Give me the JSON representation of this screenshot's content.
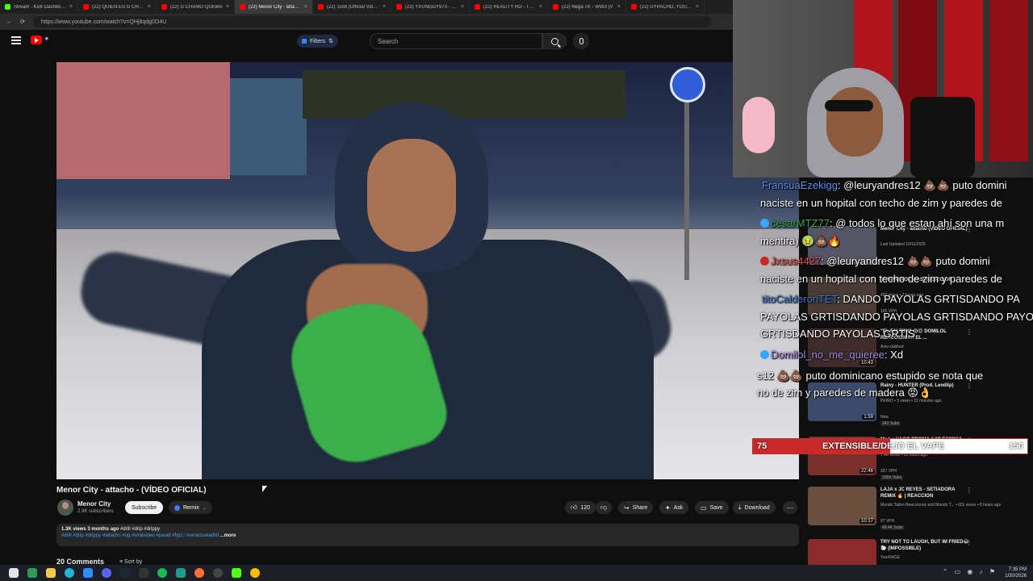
{
  "browser": {
    "tabs": [
      {
        "title": "Stream - Kick Dashboard",
        "color": "#53fc18",
        "active": false
      },
      {
        "title": "(22) QUIEN ES G CHAMO",
        "color": "#ff0000",
        "active": false
      },
      {
        "title": "(22) G CHAMO QUEMA",
        "color": "#ff0000",
        "active": false
      },
      {
        "title": "(22) Menor City - attacho",
        "color": "#ff0000",
        "active": true
      },
      {
        "title": "(22) 1vs8 (Official Video)",
        "color": "#ff0000",
        "active": false
      },
      {
        "title": "(22) YXUNGDY970 - GAR",
        "color": "#ff0000",
        "active": false
      },
      {
        "title": "(22) REALITY RD - TRUST",
        "color": "#ff0000",
        "active": false
      },
      {
        "title": "(22) Nega TK - WW3 (V",
        "color": "#ff0000",
        "active": false
      },
      {
        "title": "(22) UYPACHO, YOUNG",
        "color": "#ff0000",
        "active": false
      }
    ],
    "url": "https://www.youtube.com/watch?v=QHj8qdg0O4U"
  },
  "header": {
    "filters_label": "Filters",
    "search_placeholder": "Search"
  },
  "video": {
    "title": "Menor City - attacho - (VÍDEO OFICIAL)",
    "channel": "Menor City",
    "subscribers": "2.8K subscribers",
    "subscribe_label": "Subscribe",
    "remix_label": "Remix",
    "likes": "120",
    "share_label": "Share",
    "ask_label": "Ask",
    "save_label": "Save",
    "download_label": "Download",
    "views_date": "1.3K views  3 months ago",
    "hashtags_top": "#drill #drip #drippy",
    "hashtags": "#drill #drip #drippy #attacho #og #viralvideo #parati #fyp゚ #venezueladrill",
    "more_label": "...more",
    "comments_count": "20 Comments",
    "sort_label": "Sort by"
  },
  "chat": [
    {
      "user": "FransuaEzekigg",
      "msg": ": @leuryandres12 💩💩 puto domini"
    },
    {
      "user": "",
      "msg": "naciste en un hopital con techo de zim y paredes de"
    },
    {
      "user": "cesarMTZ77",
      "msg": ": @ todos lo que estan ahí son una m"
    },
    {
      "user": "",
      "msg": "mentira) 🤢💩🔥"
    },
    {
      "user": "Jxsus4427",
      "msg": ": @leuryandres12 💩💩 puto domini"
    },
    {
      "user": "",
      "msg": "naciste en un hopital con techo de zim y paredes de"
    },
    {
      "user": "titoCalderonTET",
      "msg": ": DANDO PAYOLAS GRTISDANDO PA"
    },
    {
      "user": "",
      "msg": "PAYOLAS GRTISDANDO PAYOLAS GRTISDANDO PAYO"
    },
    {
      "user": "",
      "msg": "GRTISDANDO PAYOLAS GRTIS"
    },
    {
      "user": "Domilol_no_me_quieree",
      "msg": ": Xd"
    },
    {
      "user": "",
      "msg": "s12 💩💩 puto dominicano estupido se nota que"
    },
    {
      "user": "",
      "msg": "no de zim y paredes de madera 😡👌"
    }
  ],
  "recommendations": [
    {
      "title": "Menor City - attacho (VIDEO OFICIAL)",
      "channel": "Last Updated 10/11/2025",
      "duration": "",
      "vph": "",
      "tag": ""
    },
    {
      "title": "SORPRENDE MAS! REACCION ...",
      "channel": "497 views • 3 hours ago",
      "duration": "",
      "vph": "165 VPH",
      "tag": ""
    },
    {
      "title": "\"EL FALTON\" 😱😍 DOMILOL REACCIONA A EL ...",
      "channel": "Auto-dubbed",
      "duration": "10:43",
      "vph": "",
      "tag": ""
    },
    {
      "title": "Rainy - HUNTER (Prod. Lendlip)",
      "channel": "PEIRO • 3 views • 32 minutes ago",
      "duration": "1:59",
      "vph": "New",
      "tag": "343 Subs"
    },
    {
      "title": "Me Le HAGO BROMA A MI ESPOSA",
      "channel": "7.9K views • 22 hours ago",
      "duration": "22:46",
      "vph": "327 VPH",
      "tag": "106K Subs"
    },
    {
      "title": "LAJA x JC REYES - SETIADORA REMIX 🔥 | REACCION",
      "channel": "Mundo Tailon Reacciones and Mundo T... • 601 views • 8 hours ago",
      "duration": "10:17",
      "vph": "97 VPH",
      "tag": "48.4K Subs"
    },
    {
      "title": "TRY NOT TO LAUGH, BUT IM FRIED😂🐑 (IMPOSSIBLE)",
      "channel": "YourRAGE",
      "duration": "",
      "vph": "",
      "tag": ""
    }
  ],
  "goal": {
    "start": "75",
    "title": "EXTENSIBLE/DEJO EL VAPE",
    "end": "150",
    "progress_fraction": 0.5
  },
  "taskbar": {
    "time": "7:35 PM",
    "date": "1/30/2026"
  }
}
